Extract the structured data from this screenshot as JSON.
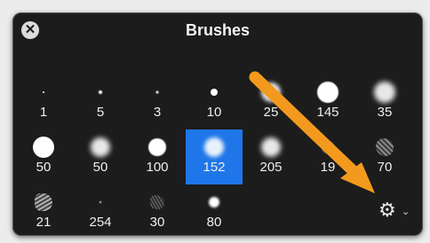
{
  "panel": {
    "title": "Brushes",
    "close_icon": "close-icon",
    "settings_icon": "gear-icon",
    "settings_chevron": "chevron-down-icon"
  },
  "brushes": [
    {
      "size_label": "1",
      "tip": "dot",
      "diameter": 2,
      "blur": 0,
      "selected": false
    },
    {
      "size_label": "5",
      "tip": "dot",
      "diameter": 4,
      "blur": 1,
      "selected": false
    },
    {
      "size_label": "3",
      "tip": "dot",
      "diameter": 3,
      "blur": 1,
      "selected": false
    },
    {
      "size_label": "10",
      "tip": "dot",
      "diameter": 8,
      "blur": 0,
      "selected": false
    },
    {
      "size_label": "25",
      "tip": "dot",
      "diameter": 22,
      "blur": 4,
      "selected": false
    },
    {
      "size_label": "145",
      "tip": "dot",
      "diameter": 24,
      "blur": 1,
      "selected": false
    },
    {
      "size_label": "35",
      "tip": "dot",
      "diameter": 24,
      "blur": 5,
      "selected": false
    },
    {
      "size_label": "50",
      "tip": "dot",
      "diameter": 24,
      "blur": 0,
      "selected": false
    },
    {
      "size_label": "50",
      "tip": "dot",
      "diameter": 22,
      "blur": 5,
      "selected": false
    },
    {
      "size_label": "100",
      "tip": "dot",
      "diameter": 20,
      "blur": 1,
      "selected": false
    },
    {
      "size_label": "152",
      "tip": "dot",
      "diameter": 22,
      "blur": 4,
      "selected": true
    },
    {
      "size_label": "205",
      "tip": "dot",
      "diameter": 22,
      "blur": 5,
      "selected": false
    },
    {
      "size_label": "19",
      "tip": "dot",
      "diameter": 12,
      "blur": 2,
      "selected": false
    },
    {
      "size_label": "70",
      "tip": "leaf",
      "diameter": 20,
      "blur": 0,
      "selected": false
    },
    {
      "size_label": "21",
      "tip": "splat",
      "diameter": 20,
      "blur": 0,
      "selected": false
    },
    {
      "size_label": "254",
      "tip": "dot",
      "diameter": 2,
      "blur": 1,
      "selected": false
    },
    {
      "size_label": "30",
      "tip": "speck",
      "diameter": 16,
      "blur": 0,
      "selected": false
    },
    {
      "size_label": "80",
      "tip": "dot",
      "diameter": 12,
      "blur": 2,
      "selected": false
    }
  ],
  "colors": {
    "panel_bg": "#1c1c1c",
    "selection": "#1f76e8",
    "annotation_arrow": "#f39a1e"
  }
}
